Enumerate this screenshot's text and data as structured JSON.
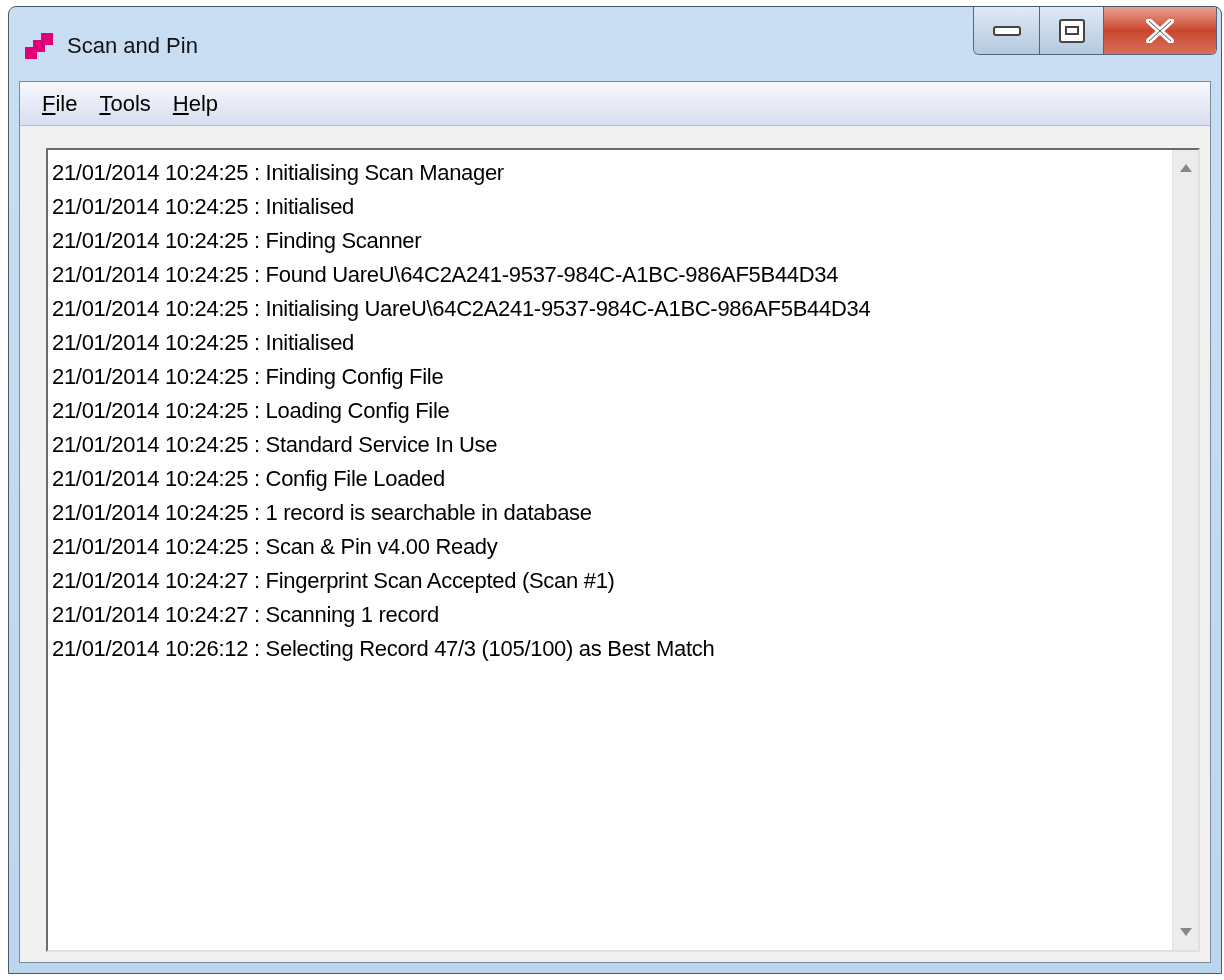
{
  "window": {
    "title": "Scan and Pin"
  },
  "menu": [
    "File",
    "Tools",
    "Help"
  ],
  "log": [
    "21/01/2014 10:24:25 : Initialising Scan Manager",
    "21/01/2014 10:24:25 : Initialised",
    "21/01/2014 10:24:25 : Finding Scanner",
    "21/01/2014 10:24:25 : Found UareU\\64C2A241-9537-984C-A1BC-986AF5B44D34",
    "21/01/2014 10:24:25 : Initialising UareU\\64C2A241-9537-984C-A1BC-986AF5B44D34",
    "21/01/2014 10:24:25 : Initialised",
    "21/01/2014 10:24:25 : Finding Config File",
    "21/01/2014 10:24:25 : Loading Config File",
    "21/01/2014 10:24:25 : Standard Service In Use",
    "21/01/2014 10:24:25 : Config File Loaded",
    "21/01/2014 10:24:25 : 1 record is searchable in database",
    "21/01/2014 10:24:25 : Scan & Pin v4.00 Ready",
    "21/01/2014 10:24:27 : Fingerprint Scan Accepted (Scan #1)",
    "21/01/2014 10:24:27 : Scanning 1 record",
    "21/01/2014 10:26:12 : Selecting Record 47/3 (105/100) as Best Match"
  ]
}
